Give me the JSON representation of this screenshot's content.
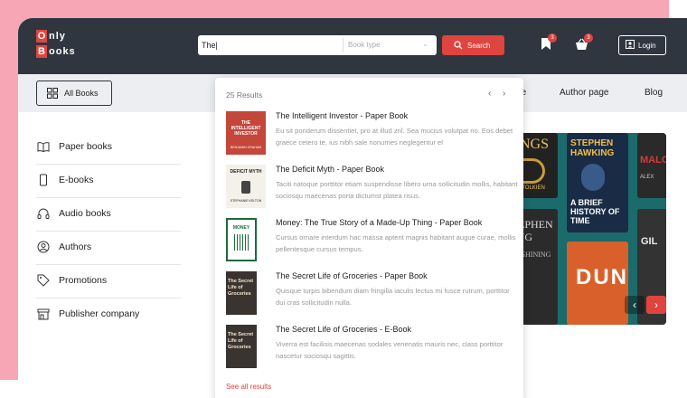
{
  "brand": {
    "line1": "nly",
    "line2": "ooks",
    "letter1": "O",
    "letter2": "B"
  },
  "search": {
    "value": "The|",
    "booktype_label": "Book type",
    "button_label": "Search"
  },
  "header": {
    "bookmark_count": "3",
    "cart_count": "3",
    "login_label": "Login"
  },
  "nav": {
    "all_books_label": "All Books",
    "links": [
      "page",
      "Author page",
      "Blog"
    ]
  },
  "sidebar": {
    "items": [
      {
        "label": "Paper books",
        "icon": "open-book-icon"
      },
      {
        "label": "E-books",
        "icon": "phone-icon"
      },
      {
        "label": "Audio books",
        "icon": "headphones-icon"
      },
      {
        "label": "Authors",
        "icon": "user-circle-icon"
      },
      {
        "label": "Promotions",
        "icon": "tag-icon"
      },
      {
        "label": "Publisher company",
        "icon": "storefront-icon"
      }
    ]
  },
  "dropdown": {
    "count": "25 Results",
    "see_all": "See all results",
    "results": [
      {
        "title": "The Intelligent Investor - Paper Book",
        "desc": "Eu sit ponderum dissentiet, pro at illud zril. Sea mucius volutpat no. Eos debet graece cetero te, ius nibh sale nonumes neglegentur el",
        "cover": {
          "bg": "#c4473a",
          "text": "THE INTELLIGENT INVESTOR",
          "sub": "BENJAMIN GRAHAM",
          "fg": "#ffffff"
        }
      },
      {
        "title": "The Deficit Myth  - Paper Book",
        "desc": "Taciti natoque porttitor etiam suspendisse libero urna sollicitudin mollis, habitant sociosqu maecenas porta dictumst platea risus.",
        "cover": {
          "bg": "#f4f1ea",
          "text": "DEFICIT MYTH",
          "sub": "STEPHANIE KELTON",
          "fg": "#222222"
        }
      },
      {
        "title": "Money: The True Story of a Made-Up Thing - Paper Book",
        "desc": "Cursus ornare interdum hac massa aptent magnis habitant augue curae, mollis pellentesque cursus tempus.",
        "cover": {
          "bg": "#ffffff",
          "text": "MONEY",
          "sub": "",
          "fg": "#1d6b3a"
        }
      },
      {
        "title": "The Secret Life of Groceries - Paper Book",
        "desc": "Quisque turpis bibendum diam fringilla iaculis lectus mi fusce rutrum, porttitor dui cras sollicitudin nulla.",
        "cover": {
          "bg": "#3a3430",
          "text": "The Secret Life of Groceries",
          "sub": "",
          "fg": "#f2e6d0"
        }
      },
      {
        "title": "The Secret Life of Groceries - E-Book",
        "desc": "Viverra est facilisis maecenas sodales venenatis mauris nec, class porttitor nascetur sociosqu sagittis.",
        "cover": {
          "bg": "#3a3430",
          "text": "The Secret Life of Groceries",
          "sub": "",
          "fg": "#f2e6d0"
        }
      }
    ]
  },
  "banner": {
    "covers": [
      {
        "text": "RINGS",
        "sub": "J.R.R. TOLKIEN",
        "bg": "#222222",
        "fg": "#e8c35a"
      },
      {
        "text": "STEPHEN HAWKING",
        "sub": "A BRIEF HISTORY OF TIME",
        "bg": "#1a2b45",
        "fg": "#f0c040"
      },
      {
        "text": "MALC",
        "sub": "ALEX",
        "bg": "#2a2a2a",
        "fg": "#d23b3b"
      },
      {
        "text": "STEPHEN KING",
        "sub": "THE SHINING",
        "bg": "#2b2b2b",
        "fg": "#dddddd"
      },
      {
        "text": "DUNE",
        "sub": "",
        "bg": "#d9602a",
        "fg": "#ffffff"
      },
      {
        "text": "GIL",
        "sub": "",
        "bg": "#333333",
        "fg": "#eeeeee"
      }
    ],
    "prev_label": "‹",
    "next_label": "›"
  },
  "colors": {
    "accent": "#e0443e",
    "dark": "#2f3640",
    "pink": "#f7a6b5"
  }
}
